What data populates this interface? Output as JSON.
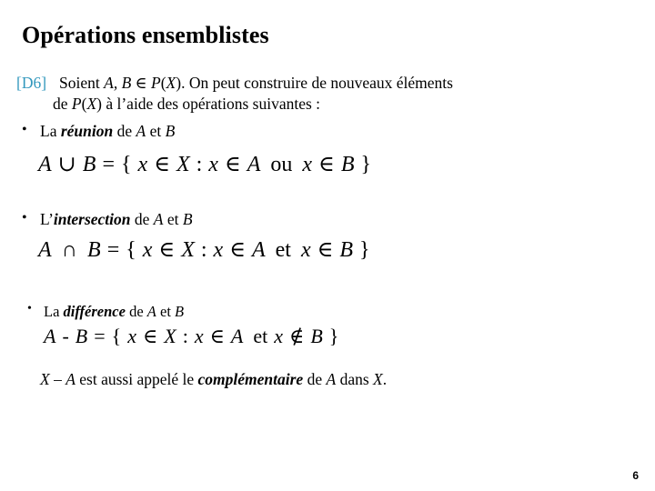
{
  "slide": {
    "title": "Opérations ensemblistes",
    "page_number": "6",
    "accent_color": "#3398bd",
    "text_color": "#000000",
    "background_color": "#ffffff"
  },
  "definition": {
    "tag": "[D6]",
    "line1_part1": "Soient ",
    "line1_italic1": "A, B",
    "line1_part2": " ",
    "line1_symbol": "∈",
    "line1_part3": " ",
    "line1_italic2": "P",
    "line1_part4": "(",
    "line1_italic3": "X",
    "line1_part5": "). On peut construire de nouveaux éléments",
    "line2_part1": "de ",
    "line2_italic1": "P",
    "line2_part2": "(",
    "line2_italic2": "X",
    "line2_part3": ") à l’aide des opérations suivantes :"
  },
  "items": [
    {
      "bullet": "•",
      "label_prefix": "La ",
      "label_term": "réunion",
      "label_suffix_pre": " de ",
      "label_var1": "A",
      "label_mid": " et ",
      "label_var2": "B",
      "formula": {
        "lhs_a": "A",
        "operator": "∪",
        "lhs_b": "B",
        "equals": "=",
        "open_brace": "{",
        "elem": "x",
        "in1": "∈",
        "universe": "X",
        "colon": ":",
        "elem2": "x",
        "in2": "∈",
        "set1": "A",
        "connector": "ou",
        "elem3": "x",
        "in3": "∈",
        "set2": "B",
        "close_brace": "}"
      }
    },
    {
      "bullet": "•",
      "label_prefix": "L’",
      "label_term": "intersection",
      "label_suffix_pre": " de ",
      "label_var1": "A",
      "label_mid": " et ",
      "label_var2": "B",
      "formula": {
        "lhs_a": "A",
        "operator": "∩",
        "lhs_b": "B",
        "equals": "=",
        "open_brace": "{",
        "elem": "x",
        "in1": "∈",
        "universe": "X",
        "colon": ":",
        "elem2": "x",
        "in2": "∈",
        "set1": "A",
        "connector": "et",
        "elem3": "x",
        "in3": "∈",
        "set2": "B",
        "close_brace": "}"
      }
    },
    {
      "bullet": "•",
      "label_prefix": "La ",
      "label_term": "différence",
      "label_suffix_pre": " de ",
      "label_var1": "A",
      "label_mid": " et ",
      "label_var2": "B",
      "formula": {
        "lhs_a": "A",
        "operator": "-",
        "lhs_b": "B",
        "equals": "=",
        "open_brace": "{",
        "elem": "x",
        "in1": "∈",
        "universe": "X",
        "colon": ":",
        "elem2": "x",
        "in2": "∈",
        "set1": "A",
        "connector": "et",
        "elem3": "x",
        "in3": "∉",
        "set2": "B",
        "close_brace": "}"
      }
    }
  ],
  "note": {
    "var1": "X",
    "dash": " – ",
    "var2": "A",
    "text1": " est aussi appelé le ",
    "term": "complémentaire",
    "text2": " de ",
    "var3": "A",
    "text3": " dans ",
    "var4": "X",
    "period": "."
  }
}
